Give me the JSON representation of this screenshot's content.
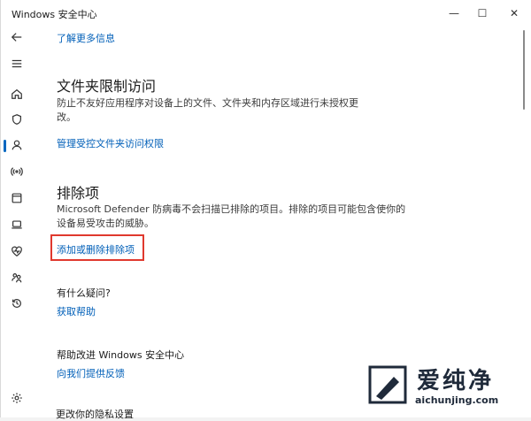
{
  "window": {
    "title": "Windows 安全中心",
    "minimize": "—",
    "maximize": "☐",
    "close": "✕"
  },
  "sidebar": {
    "icons": [
      "back-arrow-icon",
      "menu-icon",
      "home-icon",
      "shield-icon",
      "person-icon",
      "wireless-icon",
      "browser-window-icon",
      "laptop-icon",
      "heart-pulse-icon",
      "family-icon",
      "history-icon",
      "settings-gear-icon"
    ],
    "active": "shield-icon"
  },
  "content": {
    "top_link": "了解更多信息",
    "folder_access": {
      "title": "文件夹限制访问",
      "description": "防止不友好应用程序对设备上的文件、文件夹和内存区域进行未授权更改。",
      "link": "管理受控文件夹访问权限"
    },
    "exclusions": {
      "title": "排除项",
      "description": "Microsoft Defender 防病毒不会扫描已排除的项目。排除的项目可能包含使你的设备易受攻击的威胁。",
      "link": "添加或删除排除项"
    },
    "questions": {
      "title": "有什么疑问?",
      "link": "获取帮助"
    },
    "improve": {
      "title": "帮助改进 Windows 安全中心",
      "link": "向我们提供反馈"
    },
    "privacy_cutoff": "更改你的隐私设置"
  },
  "watermark": {
    "brand": "爱纯净",
    "url": "aichunjing.com"
  },
  "colors": {
    "link": "#005fb8",
    "highlight": "#e0392e",
    "accent": "#0067c0"
  }
}
